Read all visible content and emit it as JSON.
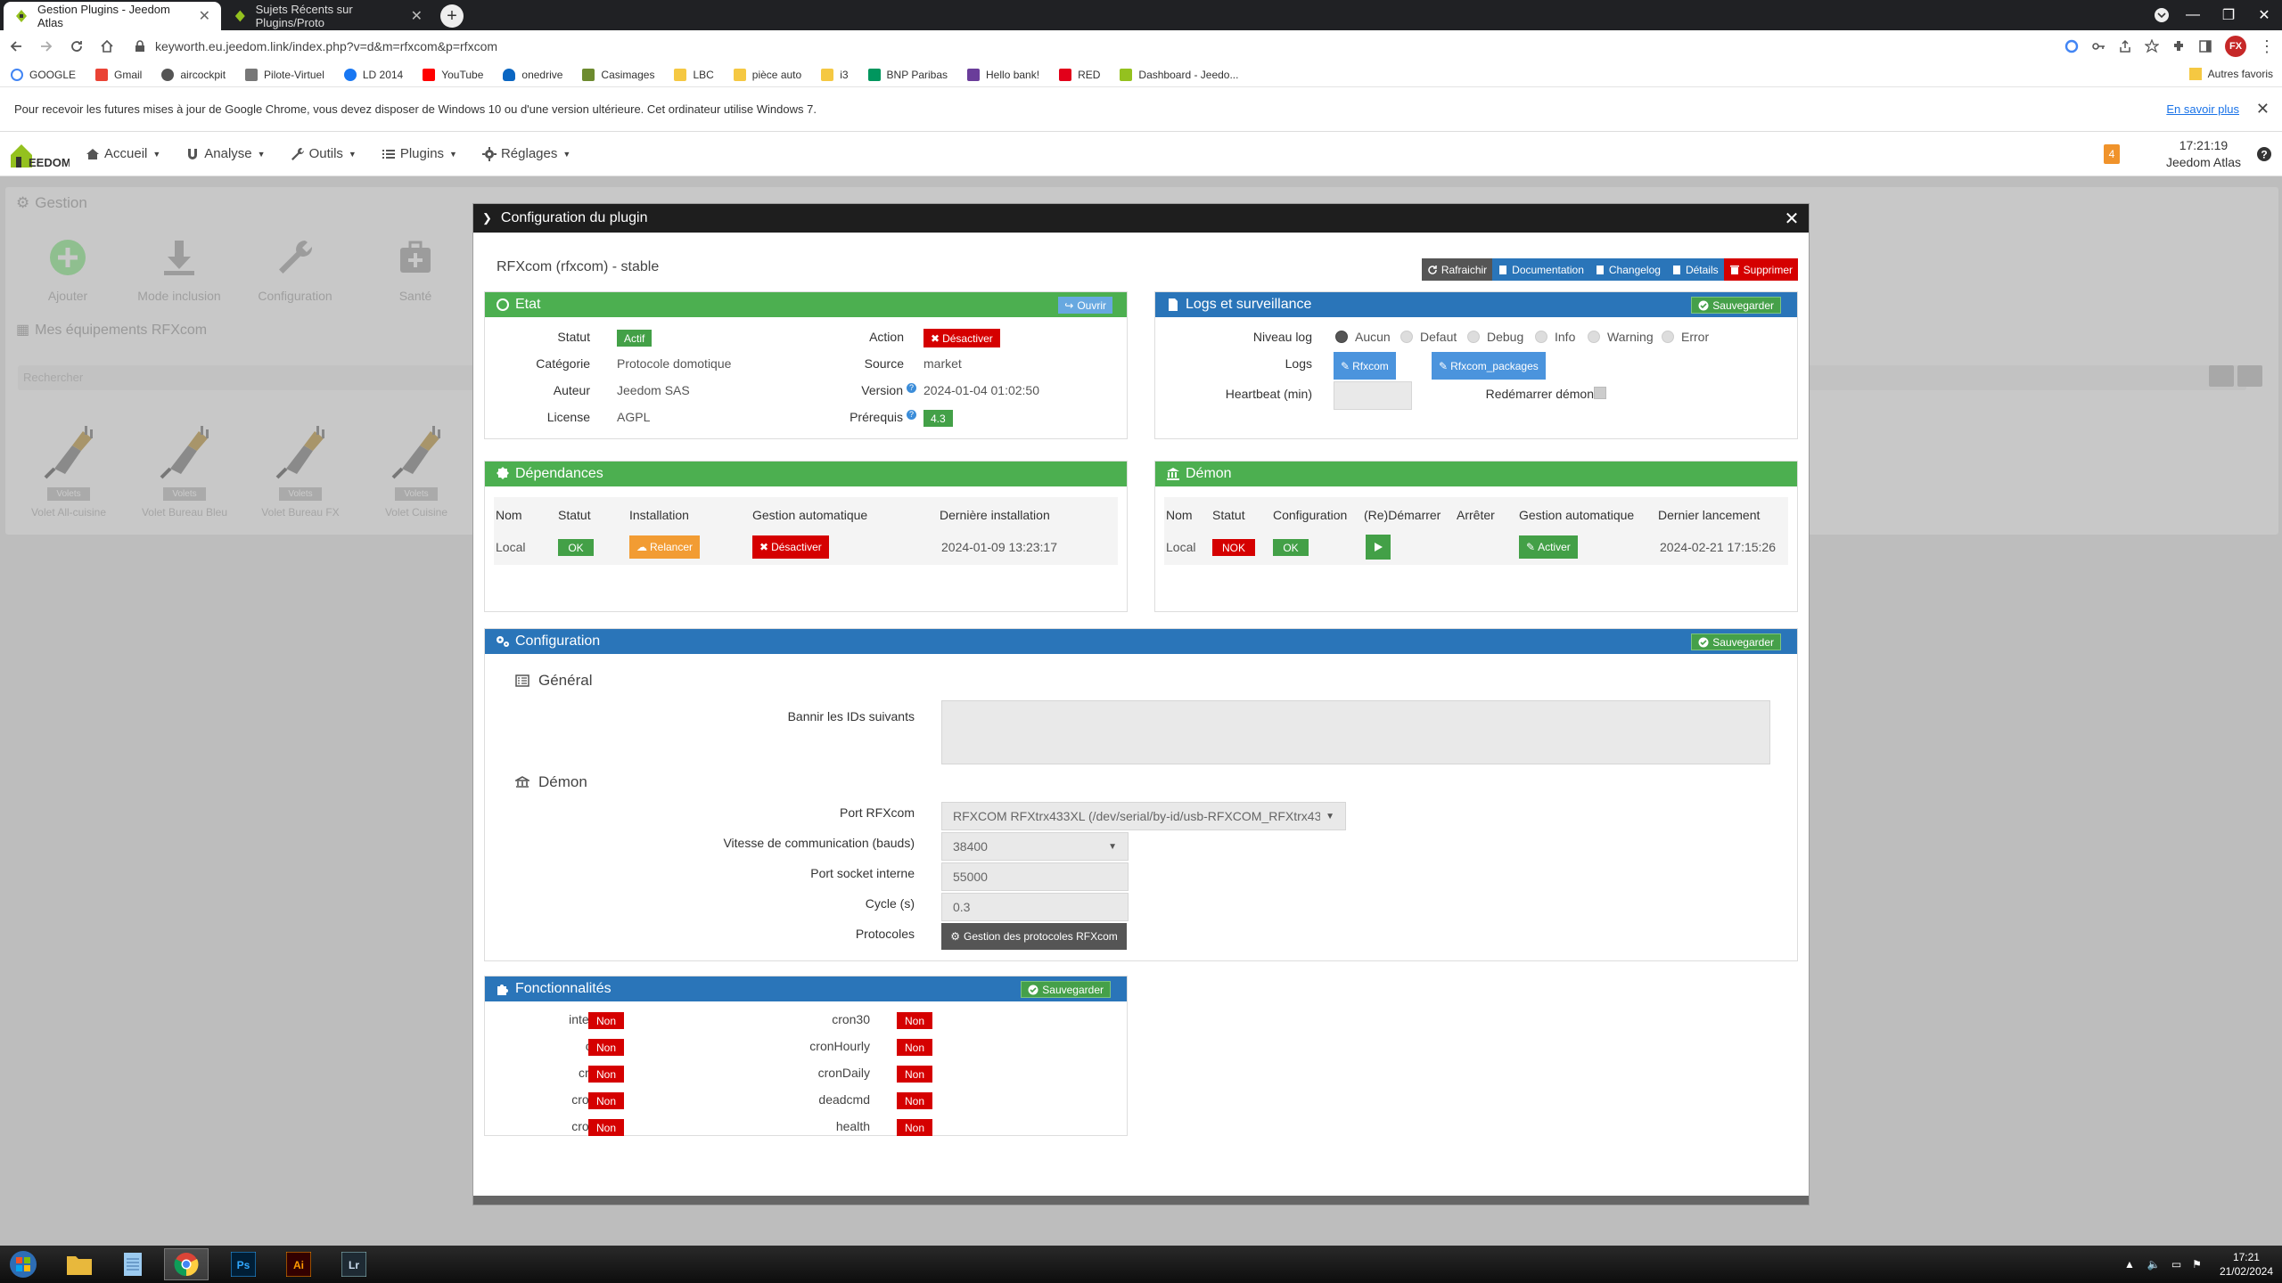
{
  "browser": {
    "tabs": [
      {
        "title": "Gestion Plugins - Jeedom Atlas",
        "active": true
      },
      {
        "title": "Sujets Récents sur Plugins/Proto",
        "active": false
      }
    ],
    "new_tab": "+",
    "url": "keyworth.eu.jeedom.link/index.php?v=d&m=rfxcom&p=rfxcom",
    "avatar": "FX",
    "bookmarks": [
      "GOOGLE",
      "Gmail",
      "aircockpit",
      "Pilote-Virtuel",
      "LD 2014",
      "YouTube",
      "onedrive",
      "Casimages",
      "LBC",
      "pièce auto",
      "i3",
      "BNP Paribas",
      "Hello bank!",
      "RED",
      "Dashboard - Jeedo..."
    ],
    "other_bookmarks": "Autres favoris",
    "infobar": {
      "text": "Pour recevoir les futures mises à jour de Google Chrome, vous devez disposer de Windows 10 ou d'une version ultérieure. Cet ordinateur utilise Windows 7.",
      "learn_more": "En savoir plus"
    }
  },
  "jeedom_nav": {
    "menus": [
      "Accueil",
      "Analyse",
      "Outils",
      "Plugins",
      "Réglages"
    ],
    "notification_count": "4",
    "time": "17:21:19",
    "instance": "Jeedom Atlas"
  },
  "background_page": {
    "section": "Gestion",
    "tools": [
      "Ajouter",
      "Mode inclusion",
      "Configuration",
      "Santé"
    ],
    "equipment_title": "Mes équipements RFXcom",
    "search_placeholder": "Rechercher",
    "equipments": [
      {
        "tag": "Volets",
        "name": "Volet All-cuisine"
      },
      {
        "tag": "Volets",
        "name": "Volet Bureau Bleu"
      },
      {
        "tag": "Volets",
        "name": "Volet Bureau FX"
      },
      {
        "tag": "Volets",
        "name": "Volet Cuisine"
      }
    ]
  },
  "modal": {
    "title": "Configuration du plugin",
    "plugin_title": "RFXcom (rfxcom) - stable",
    "top_buttons": [
      "Rafraichir",
      "Documentation",
      "Changelog",
      "Détails",
      "Supprimer"
    ],
    "etat": {
      "title": "Etat",
      "ouvrir": "Ouvrir",
      "statut_label": "Statut",
      "statut": "Actif",
      "categorie_label": "Catégorie",
      "categorie": "Protocole domotique",
      "auteur_label": "Auteur",
      "auteur": "Jeedom SAS",
      "licence_label": "License",
      "licence": "AGPL",
      "action_label": "Action",
      "action": "Désactiver",
      "source_label": "Source",
      "source": "market",
      "version_label": "Version",
      "version": "2024-01-04 01:02:50",
      "prerequis_label": "Prérequis",
      "prerequis": "4.3"
    },
    "logs": {
      "title": "Logs et surveillance",
      "save": "Sauvegarder",
      "niveau_label": "Niveau log",
      "levels": [
        "Aucun",
        "Defaut",
        "Debug",
        "Info",
        "Warning",
        "Error"
      ],
      "logs_label": "Logs",
      "log_buttons": [
        "Rfxcom",
        "Rfxcom_packages"
      ],
      "heartbeat_label": "Heartbeat (min)",
      "restart_label": "Redémarrer démon"
    },
    "deps": {
      "title": "Dépendances",
      "headers": [
        "Nom",
        "Statut",
        "Installation",
        "Gestion automatique",
        "Dernière installation"
      ],
      "row": {
        "nom": "Local",
        "statut": "OK",
        "installation": "Relancer",
        "gestion": "Désactiver",
        "derniere": "2024-01-09 13:23:17"
      }
    },
    "demon": {
      "title": "Démon",
      "headers": [
        "Nom",
        "Statut",
        "Configuration",
        "(Re)Démarrer",
        "Arrêter",
        "Gestion automatique",
        "Dernier lancement"
      ],
      "row": {
        "nom": "Local",
        "statut": "NOK",
        "configuration": "OK",
        "gestion": "Activer",
        "dernier": "2024-02-21 17:15:26"
      }
    },
    "config": {
      "title": "Configuration",
      "save": "Sauvegarder",
      "general": "Général",
      "bannir_label": "Bannir les IDs suivants",
      "demon": "Démon",
      "port_label": "Port RFXcom",
      "port_value": "RFXCOM RFXtrx433XL (/dev/serial/by-id/usb-RFXCOM_RFXtrx43",
      "vitesse_label": "Vitesse de communication (bauds)",
      "vitesse_value": "38400",
      "socket_label": "Port socket interne",
      "socket_value": "55000",
      "cycle_label": "Cycle (s)",
      "cycle_value": "0.3",
      "protocoles_label": "Protocoles",
      "protocoles_button": "Gestion des protocoles RFXcom"
    },
    "fonct": {
      "title": "Fonctionnalités",
      "save": "Sauvegarder",
      "left": [
        {
          "name": "interact",
          "value": "Non"
        },
        {
          "name": "cron",
          "value": "Non"
        },
        {
          "name": "cron5",
          "value": "Non"
        },
        {
          "name": "cron10",
          "value": "Non"
        },
        {
          "name": "cron15",
          "value": "Non"
        }
      ],
      "right": [
        {
          "name": "cron30",
          "value": "Non"
        },
        {
          "name": "cronHourly",
          "value": "Non"
        },
        {
          "name": "cronDaily",
          "value": "Non"
        },
        {
          "name": "deadcmd",
          "value": "Non"
        },
        {
          "name": "health",
          "value": "Non"
        }
      ]
    }
  },
  "taskbar": {
    "time": "17:21",
    "date": "21/02/2024"
  },
  "colors": {
    "green_header": "#4caf50",
    "blue_header": "#2a75b9",
    "red": "#d50000",
    "orange": "#f29c33"
  }
}
